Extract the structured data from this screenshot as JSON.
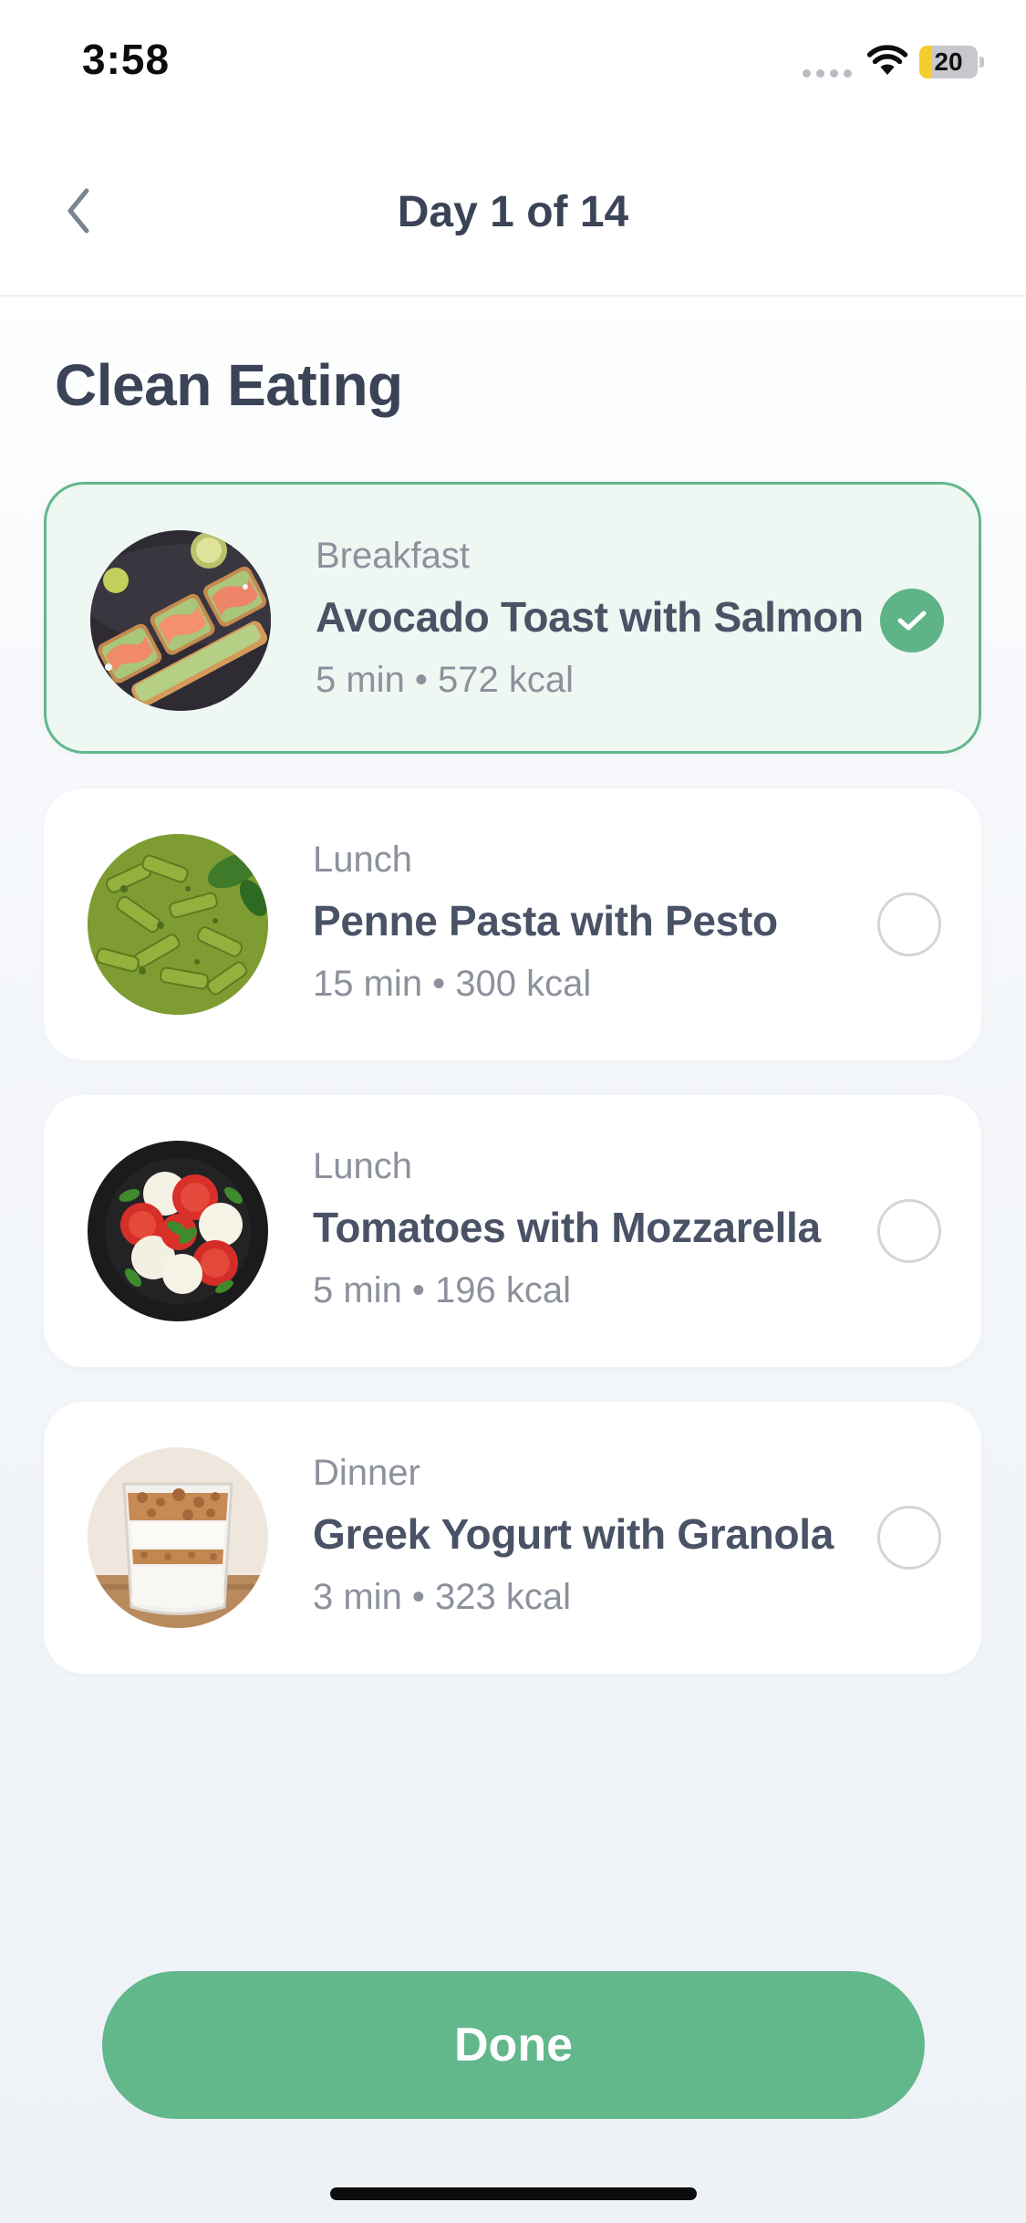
{
  "status_bar": {
    "time": "3:58",
    "battery_level": "20",
    "battery_fraction": 0.2
  },
  "nav": {
    "title": "Day 1 of 14"
  },
  "page": {
    "title": "Clean Eating"
  },
  "meals": [
    {
      "category": "Breakfast",
      "name": "Avocado Toast with Salmon",
      "meta": "5 min • 572 kcal",
      "completed": true,
      "photo": "avocado-toast-salmon"
    },
    {
      "category": "Lunch",
      "name": "Penne Pasta with Pesto",
      "meta": "15 min • 300 kcal",
      "completed": false,
      "photo": "penne-pesto"
    },
    {
      "category": "Lunch",
      "name": "Tomatoes with Mozzarella",
      "meta": "5 min • 196 kcal",
      "completed": false,
      "photo": "caprese"
    },
    {
      "category": "Dinner",
      "name": "Greek Yogurt with Granola",
      "meta": "3 min • 323 kcal",
      "completed": false,
      "photo": "yogurt-granola"
    }
  ],
  "actions": {
    "done_label": "Done"
  },
  "colors": {
    "accent": "#62b78b",
    "title_text": "#3b4357",
    "secondary_text": "#8c919c",
    "completed_card_bg": "#eef7f2"
  }
}
